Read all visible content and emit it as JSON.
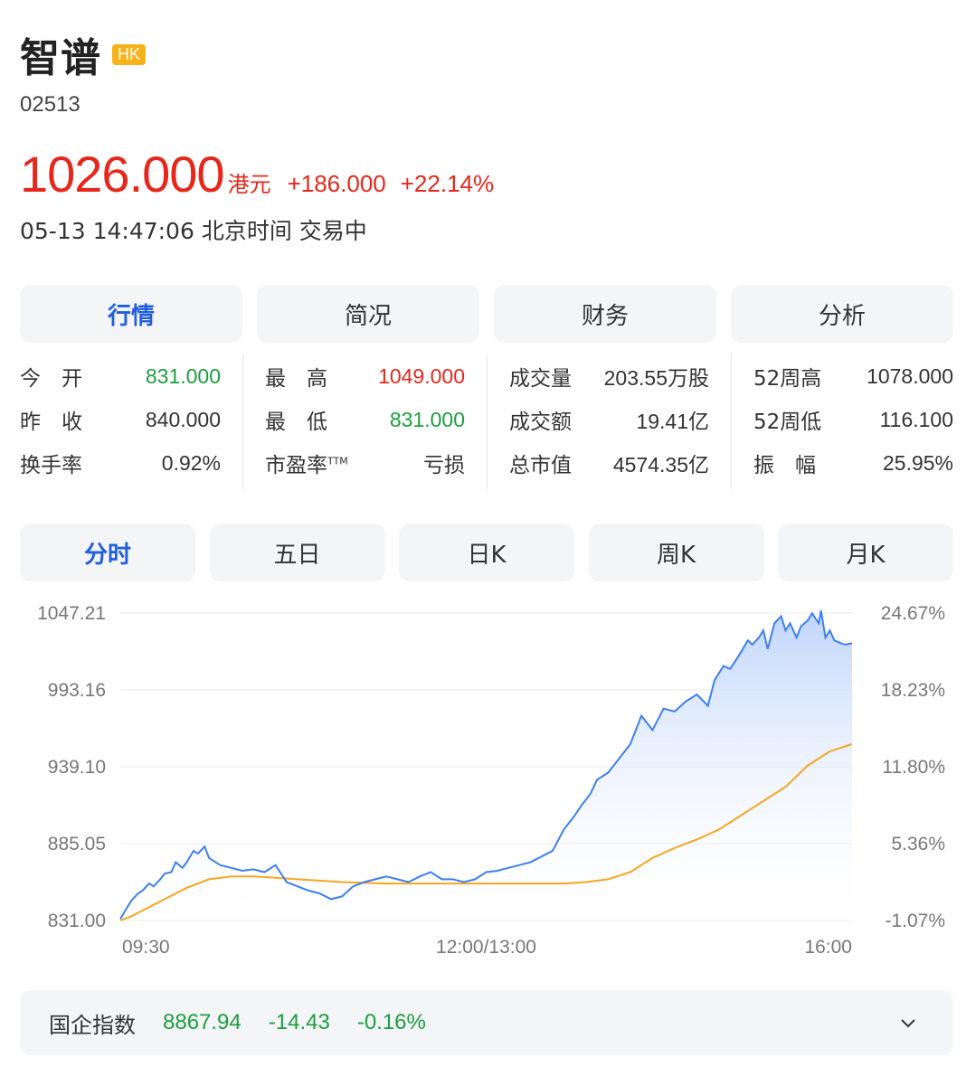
{
  "header": {
    "name": "智谱",
    "market": "HK",
    "code": "02513",
    "price": "1026.000",
    "currency": "港元",
    "change": "+186.000",
    "change_pct": "+22.14%",
    "time": "05-13 14:47:06 北京时间 交易中"
  },
  "tabs": [
    {
      "label": "行情",
      "active": true
    },
    {
      "label": "简况",
      "active": false
    },
    {
      "label": "财务",
      "active": false
    },
    {
      "label": "分析",
      "active": false
    }
  ],
  "stats": [
    [
      {
        "label": "今 开",
        "value": "831.000",
        "color": "down"
      },
      {
        "label": "昨 收",
        "value": "840.000",
        "color": ""
      },
      {
        "label": "换手率",
        "value": "0.92%",
        "color": ""
      }
    ],
    [
      {
        "label": "最 高",
        "value": "1049.000",
        "color": "up"
      },
      {
        "label": "最 低",
        "value": "831.000",
        "color": "down"
      },
      {
        "label": "市盈率",
        "label_sup": "TTM",
        "value": "亏损",
        "color": ""
      }
    ],
    [
      {
        "label": "成交量",
        "value": "203.55万股",
        "color": ""
      },
      {
        "label": "成交额",
        "value": "19.41亿",
        "color": ""
      },
      {
        "label": "总市值",
        "value": "4574.35亿",
        "color": ""
      }
    ],
    [
      {
        "label": "52周高",
        "value": "1078.000",
        "color": ""
      },
      {
        "label": "52周低",
        "value": "116.100",
        "color": ""
      },
      {
        "label": "振 幅",
        "value": "25.95%",
        "color": ""
      }
    ]
  ],
  "period_tabs": [
    {
      "label": "分时",
      "active": true
    },
    {
      "label": "五日",
      "active": false
    },
    {
      "label": "日K",
      "active": false
    },
    {
      "label": "周K",
      "active": false
    },
    {
      "label": "月K",
      "active": false
    }
  ],
  "chart_data": {
    "type": "line",
    "y_left_ticks": [
      "1047.21",
      "993.16",
      "939.10",
      "885.05",
      "831.00"
    ],
    "y_right_ticks": [
      "24.67%",
      "18.23%",
      "11.80%",
      "5.36%",
      "-1.07%"
    ],
    "x_ticks": [
      "09:30",
      "12:00/13:00",
      "16:00"
    ],
    "ylim": [
      831.0,
      1047.21
    ],
    "x_range_minutes": [
      0,
      330
    ],
    "grid": true,
    "colors": {
      "price": "#3d7ff0",
      "avg": "#f5a623",
      "fill": "#cfe0fb"
    },
    "series": [
      {
        "id": "price",
        "x": [
          0,
          3,
          5,
          8,
          10,
          13,
          15,
          18,
          20,
          23,
          25,
          28,
          30,
          33,
          35,
          38,
          40,
          45,
          50,
          55,
          60,
          65,
          70,
          75,
          80,
          85,
          90,
          95,
          100,
          105,
          110,
          115,
          120,
          125,
          130,
          135,
          140,
          145,
          150,
          155,
          160,
          165,
          170,
          175,
          180,
          185,
          190,
          195,
          200,
          205,
          208,
          212,
          215,
          220,
          225,
          230,
          235,
          240,
          245,
          250,
          255,
          260,
          265,
          268,
          272,
          275,
          278,
          280,
          283,
          285,
          288,
          290,
          292,
          295,
          298,
          300,
          302,
          305,
          307,
          310,
          312,
          315,
          316,
          318,
          320,
          322,
          325,
          327,
          330
        ],
        "values": [
          832,
          840,
          845,
          850,
          852,
          857,
          855,
          860,
          864,
          865,
          872,
          868,
          872,
          880,
          878,
          883,
          875,
          870,
          868,
          866,
          867,
          865,
          870,
          858,
          855,
          852,
          850,
          846,
          848,
          855,
          858,
          860,
          862,
          860,
          858,
          862,
          865,
          860,
          860,
          858,
          860,
          865,
          866,
          868,
          870,
          872,
          876,
          880,
          895,
          905,
          912,
          920,
          930,
          935,
          945,
          955,
          975,
          965,
          980,
          978,
          985,
          990,
          982,
          1000,
          1010,
          1008,
          1015,
          1020,
          1028,
          1025,
          1030,
          1035,
          1022,
          1040,
          1045,
          1035,
          1040,
          1030,
          1038,
          1042,
          1047,
          1040,
          1049,
          1030,
          1035,
          1028,
          1026,
          1025,
          1026
        ]
      },
      {
        "id": "avg",
        "x": [
          0,
          5,
          10,
          15,
          20,
          25,
          30,
          40,
          50,
          60,
          70,
          80,
          100,
          120,
          140,
          160,
          180,
          200,
          210,
          220,
          230,
          240,
          250,
          260,
          270,
          280,
          290,
          300,
          310,
          320,
          330
        ],
        "values": [
          831,
          834,
          838,
          842,
          846,
          850,
          854,
          860,
          862,
          862,
          861,
          860,
          858,
          857,
          857,
          857,
          857,
          857,
          858,
          860,
          865,
          875,
          882,
          888,
          895,
          905,
          915,
          925,
          940,
          950,
          955
        ]
      }
    ]
  },
  "index_bar": {
    "name": "国企指数",
    "value": "8867.94",
    "change": "-14.43",
    "change_pct": "-0.16%",
    "chevron": "chevron-down-icon"
  }
}
